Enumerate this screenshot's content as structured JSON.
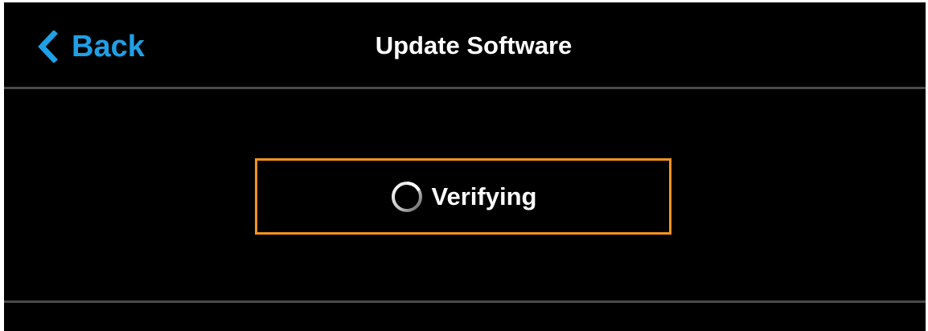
{
  "header": {
    "back_label": "Back",
    "title": "Update Software"
  },
  "status": {
    "text": "Verifying"
  },
  "colors": {
    "accent": "#1fa0e6",
    "highlight_border": "#f7941d",
    "background": "#000000",
    "divider": "#4a4a4a"
  },
  "icons": {
    "back": "chevron-left-icon",
    "progress": "spinner-icon"
  }
}
